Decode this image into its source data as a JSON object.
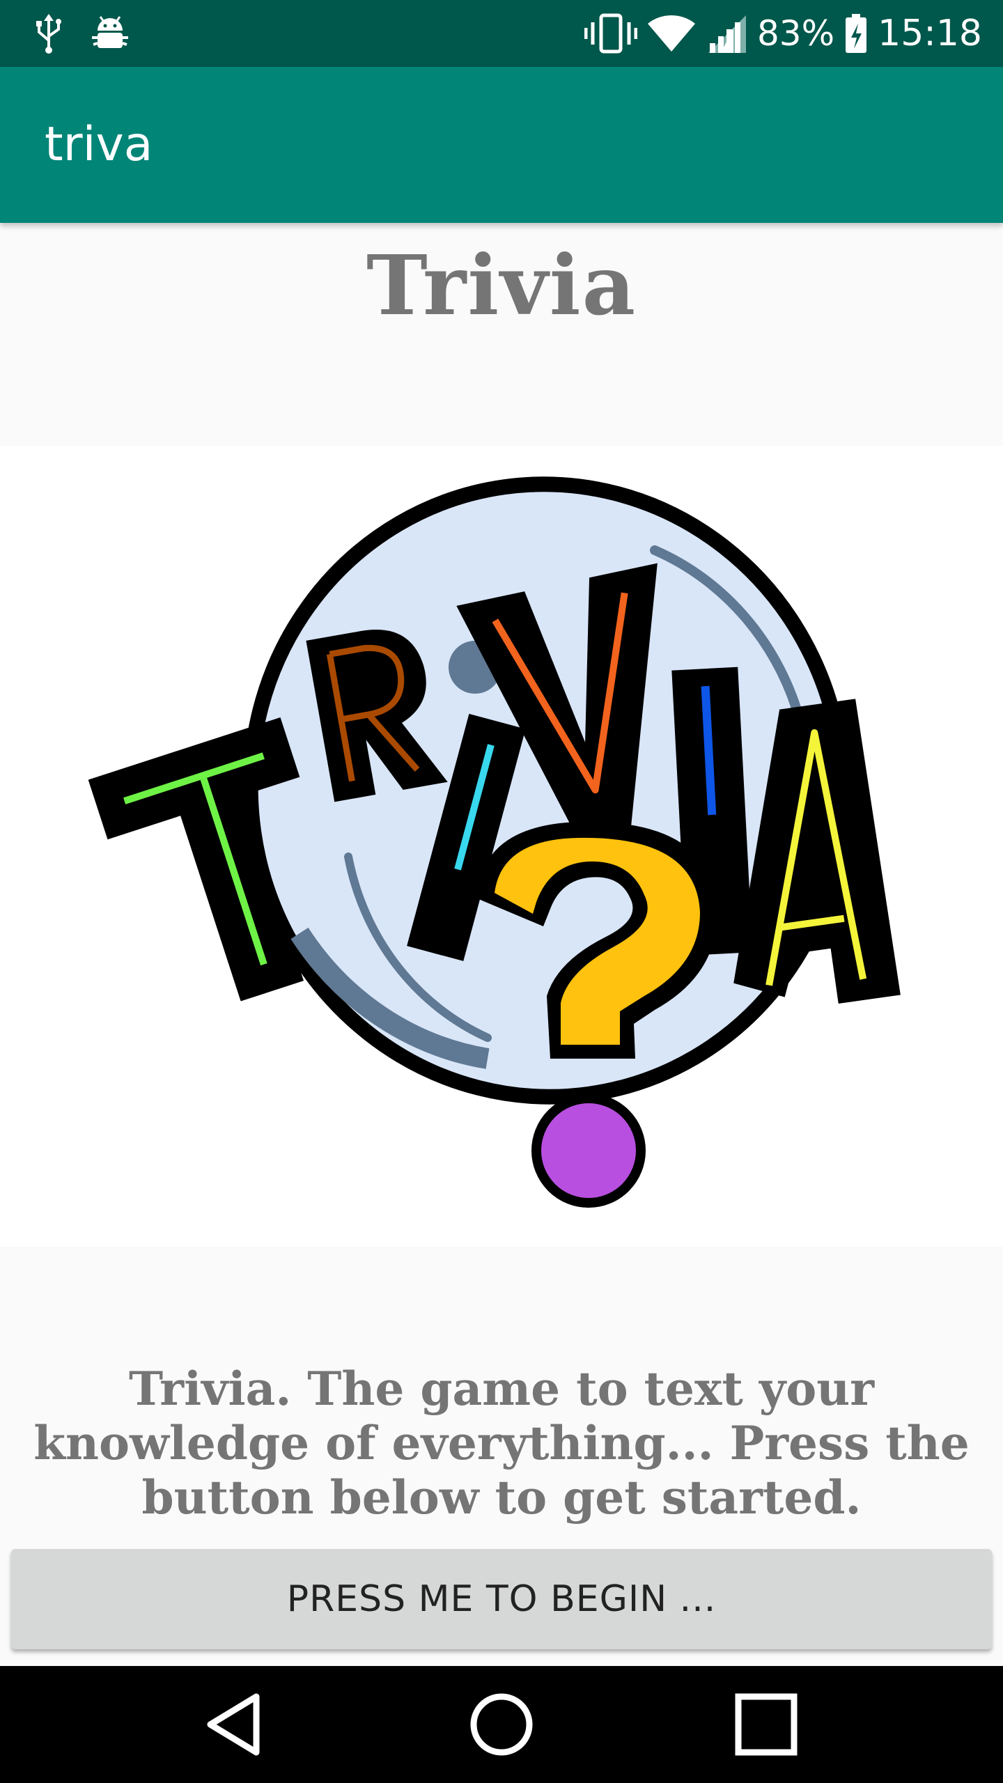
{
  "status_bar": {
    "icons_left": [
      "usb-icon",
      "android-debug-icon"
    ],
    "icons_right": [
      "vibrate-icon",
      "wifi-icon",
      "signal-icon",
      "battery-charging-icon"
    ],
    "battery_percent": "83%",
    "time": "15:18"
  },
  "app_bar": {
    "title": "triva"
  },
  "main": {
    "heading": "Trivia",
    "logo": {
      "icon": "trivia-logo-image",
      "letters": [
        "T",
        "R",
        "I",
        "V",
        "I",
        "A"
      ]
    },
    "description": "Trivia. The game to text your knowledge of everything... Press the button below to get started.",
    "begin_button_label": "PRESS ME TO BEGIN ..."
  },
  "nav_bar": {
    "back": "back-icon",
    "home": "home-icon",
    "recents": "recents-icon"
  },
  "colors": {
    "status_bar": "#00574b",
    "app_bar": "#008577",
    "text_gray": "#757575",
    "button": "#d6d7d7",
    "question_mark": "#ffc20e",
    "dot": "#b84fe0",
    "bubble": "#d9e6f8"
  }
}
